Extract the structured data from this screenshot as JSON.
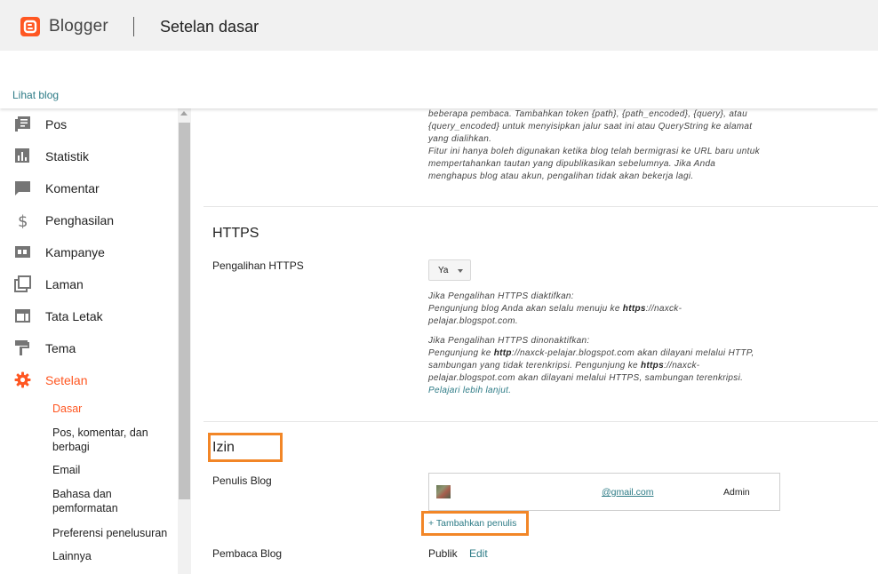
{
  "header": {
    "brand": "Blogger",
    "page_title": "Setelan dasar"
  },
  "view_blog_label": "Lihat blog",
  "sidebar": {
    "items": [
      {
        "label": "Pos",
        "icon": "posts-icon"
      },
      {
        "label": "Statistik",
        "icon": "stats-icon"
      },
      {
        "label": "Komentar",
        "icon": "comment-icon"
      },
      {
        "label": "Penghasilan",
        "icon": "dollar-icon"
      },
      {
        "label": "Kampanye",
        "icon": "ad-icon"
      },
      {
        "label": "Laman",
        "icon": "pages-icon"
      },
      {
        "label": "Tata Letak",
        "icon": "layout-icon"
      },
      {
        "label": "Tema",
        "icon": "paint-roller-icon"
      },
      {
        "label": "Setelan",
        "icon": "gear-icon"
      }
    ],
    "sub_items": [
      {
        "label": "Dasar"
      },
      {
        "label": "Pos, komentar, dan berbagi"
      },
      {
        "label": "Email"
      },
      {
        "label": "Bahasa dan pemformatan"
      },
      {
        "label": "Preferensi penelusuran"
      },
      {
        "label": "Lainnya"
      }
    ]
  },
  "redirect_note": {
    "line1": "beberapa pembaca. Tambahkan token {path}, {path_encoded}, {query}, atau",
    "line2": "{query_encoded} untuk menyisipkan jalur saat ini atau QueryString ke alamat",
    "line3": "yang dialihkan.",
    "line4": "Fitur ini hanya boleh digunakan ketika blog telah bermigrasi ke URL baru untuk",
    "line5": "mempertahankan tautan yang dipublikasikan sebelumnya. Jika Anda",
    "line6": "menghapus blog atau akun, pengalihan tidak akan bekerja lagi."
  },
  "https": {
    "title": "HTTPS",
    "redirect_label": "Pengalihan HTTPS",
    "redirect_value": "Ya",
    "enabled_heading": "Jika Pengalihan HTTPS diaktifkan:",
    "enabled_line1_pre": "Pengunjung blog Anda akan selalu menuju ke ",
    "enabled_line1_bold": "https",
    "enabled_line1_post": "://naxck-",
    "enabled_line2": "pelajar.blogspot.com.",
    "disabled_heading": "Jika Pengalihan HTTPS dinonaktifkan:",
    "disabled_line1_pre": "Pengunjung ke ",
    "disabled_line1_bold": "http",
    "disabled_line1_post": "://naxck-pelajar.blogspot.com akan dilayani melalui HTTP,",
    "disabled_line2_pre": "sambungan yang tidak terenkripsi. Pengunjung ke ",
    "disabled_line2_bold": "https",
    "disabled_line2_post": "://naxck-",
    "disabled_line3": "pelajar.blogspot.com akan dilayani melalui HTTPS, sambungan terenkripsi.",
    "learn_more": "Pelajari lebih lanjut."
  },
  "permissions": {
    "title": "Izin",
    "authors_label": "Penulis Blog",
    "author_email": "@gmail.com",
    "author_role": "Admin",
    "add_author": "+ Tambahkan penulis",
    "readers_label": "Pembaca Blog",
    "readers_value": "Publik",
    "readers_edit": "Edit"
  },
  "colors": {
    "accent": "#ff5722",
    "link": "#2d7b86",
    "highlight": "#f28627"
  }
}
